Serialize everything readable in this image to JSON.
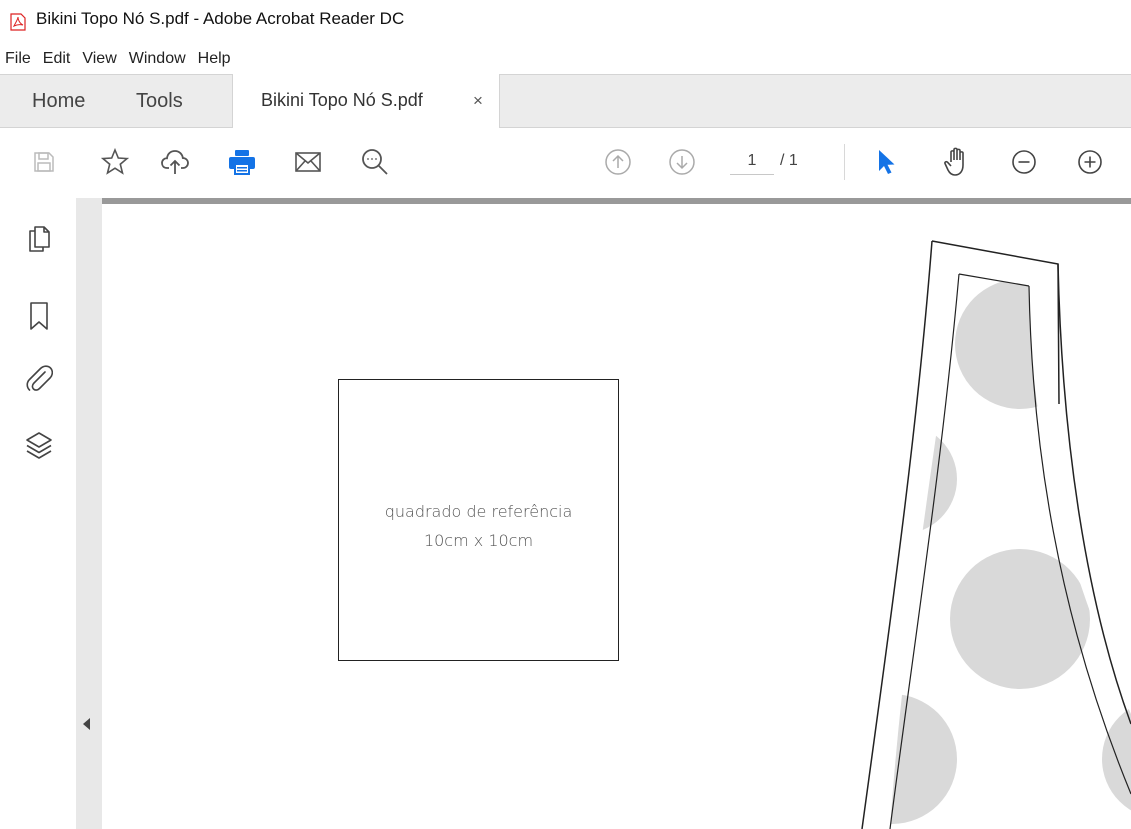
{
  "window": {
    "title": "Bikini Topo Nó S.pdf - Adobe Acrobat Reader DC"
  },
  "menu": [
    "File",
    "Edit",
    "View",
    "Window",
    "Help"
  ],
  "tabs": {
    "home": "Home",
    "tools": "Tools",
    "document": "Bikini Topo Nó S.pdf",
    "close_glyph": "×"
  },
  "toolbar": {
    "icons": [
      "save-icon",
      "bookmark-star-icon",
      "upload-cloud-icon",
      "print-icon",
      "email-icon",
      "search-icon",
      "previous-page-icon",
      "next-page-icon",
      "select-pointer-icon",
      "hand-tool-icon",
      "zoom-out-icon",
      "zoom-in-icon"
    ],
    "current_page": "1",
    "page_total": "/ 1",
    "accent_color": "#1473e6"
  },
  "left_panel": {
    "icons": [
      "page-thumbnails-icon",
      "bookmarks-icon",
      "attachments-icon",
      "layers-icon"
    ]
  },
  "document": {
    "reference_label_line1": "quadrado de referência",
    "reference_label_line2": "10cm x 10cm"
  }
}
